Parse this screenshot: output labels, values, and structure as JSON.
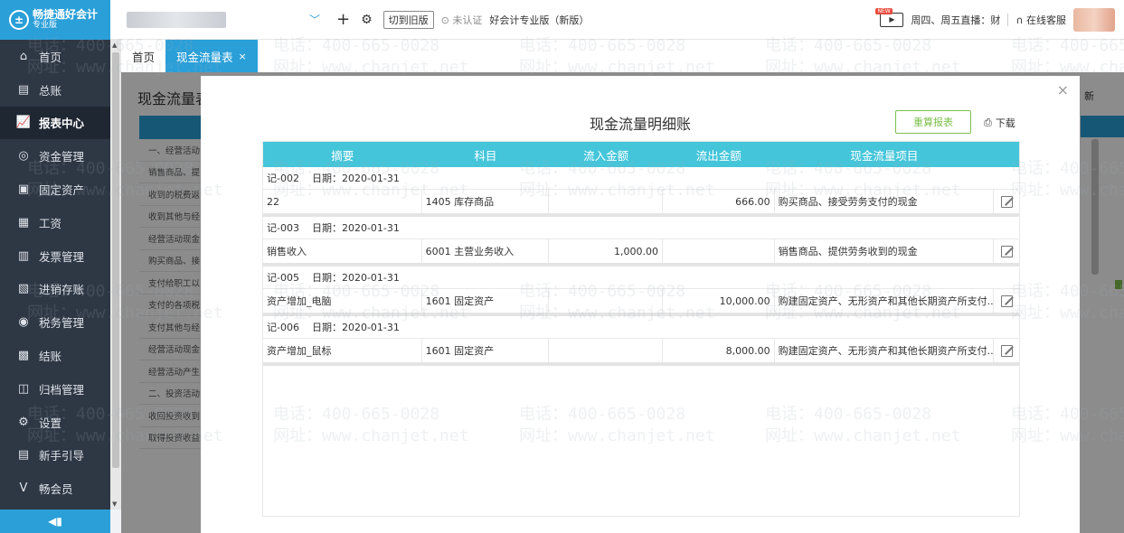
{
  "app": {
    "logo_name": "畅捷通好会计",
    "logo_sub": "专业版"
  },
  "sidebar": {
    "items": [
      {
        "label": "首页",
        "icon": "home-icon"
      },
      {
        "label": "总账",
        "icon": "ledger-icon"
      },
      {
        "label": "报表中心",
        "icon": "chart-icon",
        "active": true
      },
      {
        "label": "资金管理",
        "icon": "money-icon"
      },
      {
        "label": "固定资产",
        "icon": "asset-icon"
      },
      {
        "label": "工资",
        "icon": "salary-icon"
      },
      {
        "label": "发票管理",
        "icon": "invoice-icon"
      },
      {
        "label": "进销存账",
        "icon": "inventory-icon"
      },
      {
        "label": "税务管理",
        "icon": "tax-icon"
      },
      {
        "label": "结账",
        "icon": "closing-icon"
      },
      {
        "label": "归档管理",
        "icon": "archive-icon"
      },
      {
        "label": "设置",
        "icon": "gear-icon"
      },
      {
        "label": "新手引导",
        "icon": "guide-icon"
      },
      {
        "label": "畅会员",
        "icon": "vip-icon"
      }
    ]
  },
  "topbar": {
    "switch_label": "切到旧版",
    "cert_label": "未认证",
    "edition": "好会计专业版（新版）",
    "live_badge": "NEW",
    "live_text": "周四、周五直播：财",
    "service": "在线客服"
  },
  "tabs": [
    {
      "label": "首页"
    },
    {
      "label": "现金流量表",
      "close": "×"
    }
  ],
  "background_page": {
    "title": "现金流量表",
    "rows": [
      "一、经营活动",
      "销售商品、提",
      "收到的税费返",
      "收到其他与经",
      "经营活动现金",
      "购买商品、接",
      "支付给职工以",
      "支付的各项税",
      "支付其他与经",
      "经营活动现金",
      "经营活动产生",
      "二、投资活动",
      "收回投资收到",
      "取得投资收益"
    ],
    "right_label": "新"
  },
  "modal": {
    "title": "现金流量明细账",
    "recalc_label": "重算报表",
    "download_label": "下载",
    "close": "×",
    "columns": [
      "摘要",
      "科目",
      "流入金额",
      "流出金额",
      "现金流量项目"
    ],
    "groups": [
      {
        "voucher": "记-002",
        "date": "日期：2020-01-31",
        "row": {
          "summary": "22",
          "account": "1405 库存商品",
          "inflow": "",
          "outflow": "666.00",
          "item": "购买商品、接受劳务支付的现金"
        }
      },
      {
        "voucher": "记-003",
        "date": "日期：2020-01-31",
        "row": {
          "summary": "销售收入",
          "account": "6001 主营业务收入",
          "inflow": "1,000.00",
          "outflow": "",
          "item": "销售商品、提供劳务收到的现金"
        }
      },
      {
        "voucher": "记-005",
        "date": "日期：2020-01-31",
        "row": {
          "summary": "资产增加_电脑",
          "account": "1601 固定资产",
          "inflow": "",
          "outflow": "10,000.00",
          "item": "购建固定资产、无形资产和其他长期资产所支付..."
        }
      },
      {
        "voucher": "记-006",
        "date": "日期：2020-01-31",
        "row": {
          "summary": "资产增加_鼠标",
          "account": "1601 固定资产",
          "inflow": "",
          "outflow": "8,000.00",
          "item": "购建固定资产、无形资产和其他长期资产所支付..."
        }
      }
    ]
  },
  "watermark": {
    "phone": "电话：400-665-0028",
    "site": "网址：www.chanjet.net"
  }
}
